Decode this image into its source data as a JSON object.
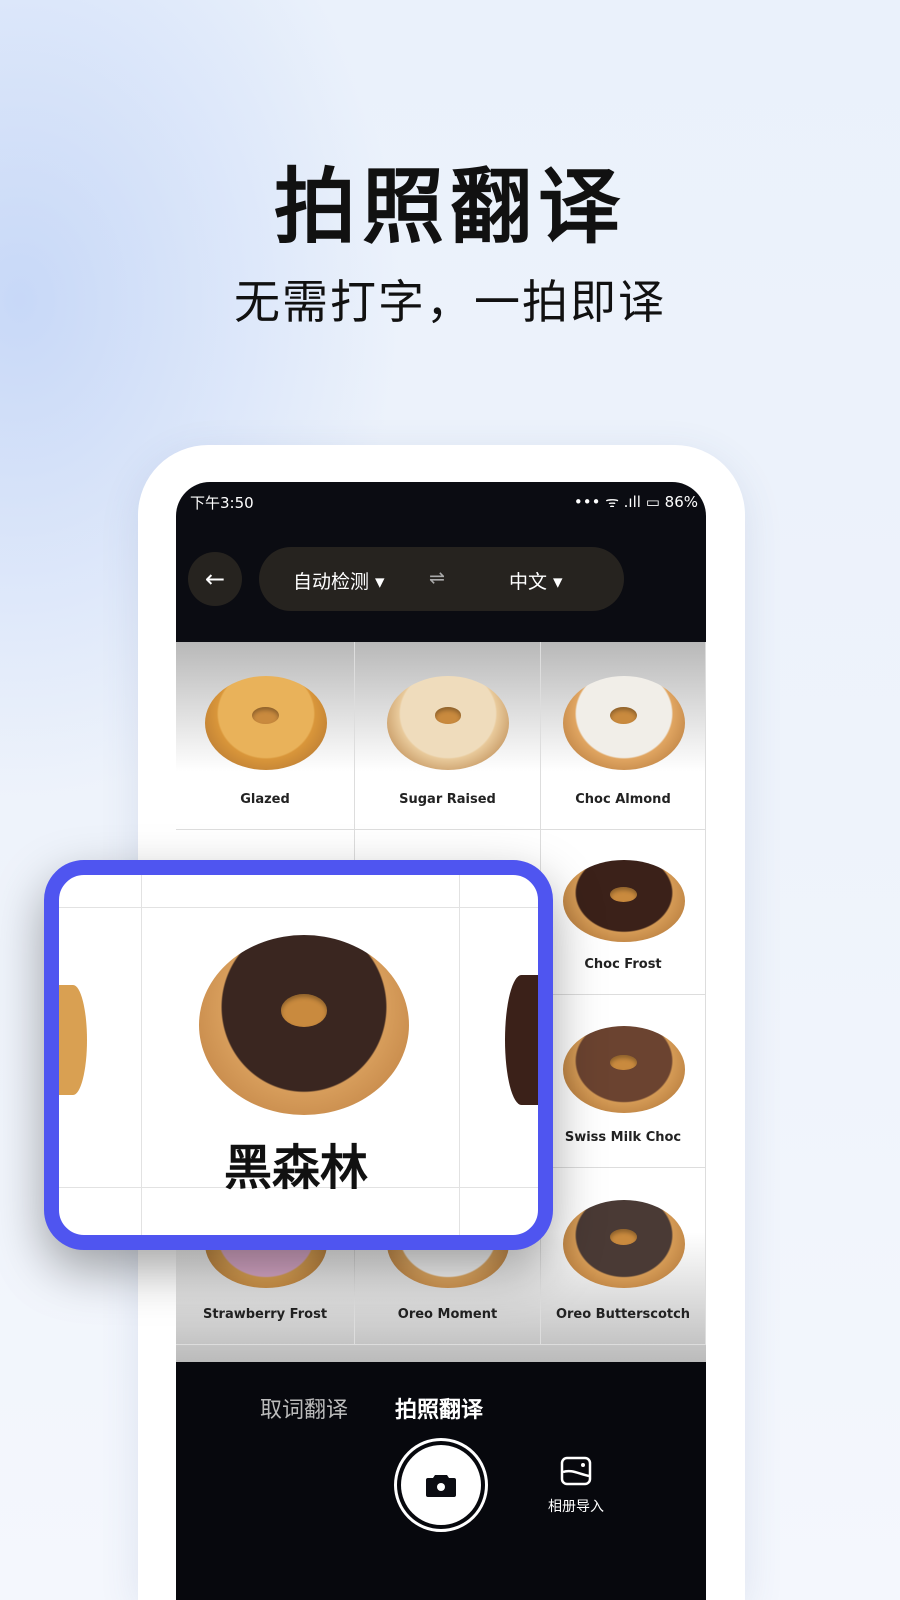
{
  "headline": "拍照翻译",
  "subheadline": "无需打字，一拍即译",
  "status": {
    "time": "下午3:50",
    "battery": "86%"
  },
  "toolbar": {
    "source_lang": "自动检测",
    "target_lang": "中文"
  },
  "grid": {
    "items": [
      {
        "label": "Glazed",
        "color": "#d9963a",
        "top": "#e9b25a"
      },
      {
        "label": "Sugar Raised",
        "color": "#e8c99a",
        "top": "#efdcbc"
      },
      {
        "label": "Choc Almond",
        "color": "#e0a561",
        "top": "#f1eee8"
      },
      {
        "label": "",
        "color": "",
        "top": ""
      },
      {
        "label": "",
        "color": "",
        "top": ""
      },
      {
        "label": "Choc Frost",
        "color": "#d49a55",
        "top": "#3b2119"
      },
      {
        "label": "",
        "color": "",
        "top": ""
      },
      {
        "label": "",
        "color": "",
        "top": ""
      },
      {
        "label": "Swiss Milk Choc",
        "color": "#d49a55",
        "top": "#6b4330"
      },
      {
        "label": "Strawberry Frost",
        "color": "#d9a052",
        "top": "#d8a8c8"
      },
      {
        "label": "Oreo Moment",
        "color": "#e0a861",
        "top": "#f5f5f5"
      },
      {
        "label": "Oreo Butterscotch",
        "color": "#d49a55",
        "top": "#4a3a35"
      }
    ]
  },
  "magnifier": {
    "translation": "黑森林",
    "accent": "#4f55f0"
  },
  "bottom": {
    "tabs": [
      "取词翻译",
      "拍照翻译"
    ],
    "active_tab": "拍照翻译",
    "album_label": "相册导入"
  }
}
